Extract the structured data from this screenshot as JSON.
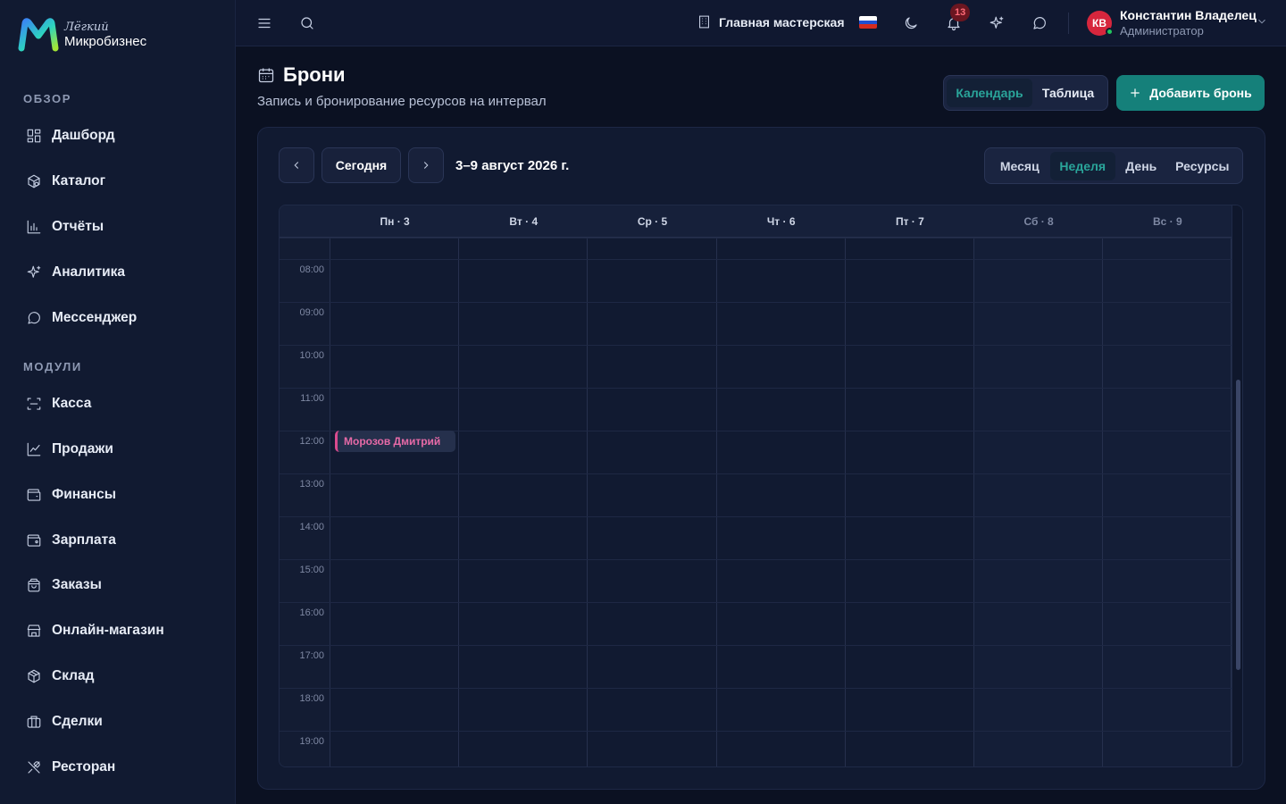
{
  "app": {
    "logo_top": "Лёгкий",
    "logo_bottom": "Микробизнес"
  },
  "sidebar": {
    "sections": [
      {
        "title": "ОБЗОР",
        "items": [
          {
            "label": "Дашборд",
            "icon": "dashboard-icon"
          },
          {
            "label": "Каталог",
            "icon": "catalog-icon"
          },
          {
            "label": "Отчёты",
            "icon": "reports-icon"
          },
          {
            "label": "Аналитика",
            "icon": "sparkles-icon"
          },
          {
            "label": "Мессенджер",
            "icon": "chat-icon"
          }
        ]
      },
      {
        "title": "МОДУЛИ",
        "items": [
          {
            "label": "Касса",
            "icon": "scan-icon"
          },
          {
            "label": "Продажи",
            "icon": "sales-chart-icon"
          },
          {
            "label": "Финансы",
            "icon": "wallet-icon"
          },
          {
            "label": "Зарплата",
            "icon": "salary-wallet-icon"
          },
          {
            "label": "Заказы",
            "icon": "shopping-bag-icon"
          },
          {
            "label": "Онлайн-магазин",
            "icon": "store-icon"
          },
          {
            "label": "Склад",
            "icon": "box-icon"
          },
          {
            "label": "Сделки",
            "icon": "briefcase-icon"
          },
          {
            "label": "Ресторан",
            "icon": "utensils-icon"
          }
        ]
      }
    ]
  },
  "topbar": {
    "workshop": "Главная мастерская",
    "notifications_count": "13",
    "user_initials": "КВ",
    "user_name": "Константин Владелец",
    "user_role": "Администратор",
    "flag_colors": [
      "#ffffff",
      "#1f4fd1",
      "#d52b1e"
    ],
    "avatar_color": "#d7263d"
  },
  "page": {
    "title": "Брони",
    "subtitle": "Запись и бронирование ресурсов на интервал",
    "view_toggle": [
      "Календарь",
      "Таблица"
    ],
    "active_view": "Календарь",
    "add_button": "Добавить бронь"
  },
  "calendar": {
    "today_label": "Сегодня",
    "range": "3–9 август 2026 г.",
    "modes": [
      "Месяц",
      "Неделя",
      "День",
      "Ресурсы"
    ],
    "active_mode": "Неделя",
    "days": [
      {
        "label": "Пн · 3",
        "weekend": false
      },
      {
        "label": "Вт · 4",
        "weekend": false
      },
      {
        "label": "Ср · 5",
        "weekend": false
      },
      {
        "label": "Чт · 6",
        "weekend": false
      },
      {
        "label": "Пт · 7",
        "weekend": false
      },
      {
        "label": "Сб · 8",
        "weekend": true
      },
      {
        "label": "Вс · 9",
        "weekend": true
      }
    ],
    "hours": [
      "08:00",
      "09:00",
      "10:00",
      "11:00",
      "12:00",
      "13:00",
      "14:00",
      "15:00",
      "16:00",
      "17:00",
      "18:00",
      "19:00"
    ],
    "events": [
      {
        "title": "Морозов Дмитрий",
        "day": "Пн · 3",
        "start": "12:00",
        "color": "#d94b8e"
      }
    ]
  },
  "colors": {
    "accent": "#15807a",
    "accent_text": "#2aa59a",
    "background": "#0b1122",
    "sidebar": "#111a31"
  }
}
